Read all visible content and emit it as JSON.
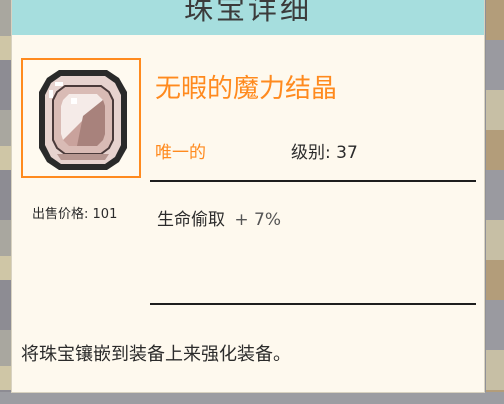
{
  "dialog": {
    "title": "珠宝详细"
  },
  "item": {
    "name": "无暇的魔力结晶",
    "rarity": "唯一的",
    "level_label": "级别:",
    "level_value": "37",
    "price_label": "出售价格:",
    "price_value": "101",
    "stat_name": "生命偷取",
    "stat_value": "+ 7%",
    "icon": "gem-crystal-icon",
    "description": "将珠宝镶嵌到装备上来强化装备。"
  },
  "colors": {
    "title_bar": "#a6dede",
    "panel": "#fef9ee",
    "accent_orange": "#ff8a1e",
    "text": "#2b2b2b"
  }
}
